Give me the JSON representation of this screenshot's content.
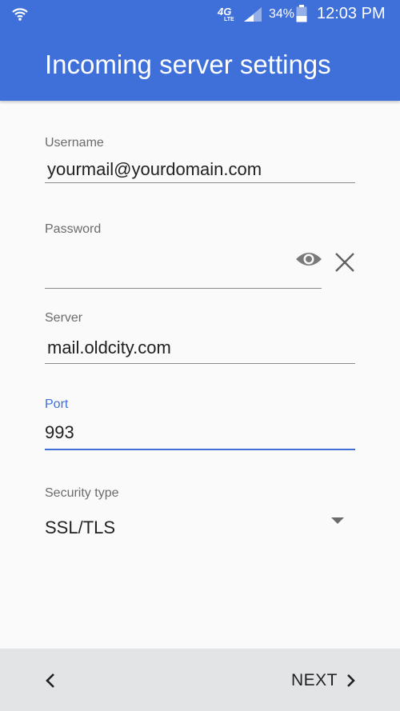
{
  "status_bar": {
    "network": "4G",
    "network_sub": "LTE",
    "battery": "34%",
    "time": "12:03 PM",
    "icons": [
      "wifi-icon",
      "signal-icon",
      "battery-icon"
    ]
  },
  "header": {
    "title": "Incoming server settings"
  },
  "form": {
    "username": {
      "label": "Username",
      "value": "yourmail@yourdomain.com"
    },
    "password": {
      "label": "Password",
      "value": ""
    },
    "server": {
      "label": "Server",
      "value": "mail.oldcity.com"
    },
    "port": {
      "label": "Port",
      "value": "993"
    },
    "security": {
      "label": "Security type",
      "value": "SSL/TLS"
    }
  },
  "footer": {
    "next_label": "NEXT"
  },
  "colors": {
    "accent": "#3f6fd8",
    "background": "#fafafa",
    "footer_bg": "#e3e4e6"
  }
}
